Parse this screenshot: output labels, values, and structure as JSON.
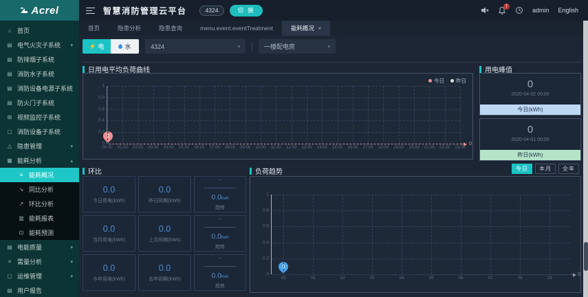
{
  "brand": {
    "logo_text": "Acrel"
  },
  "header": {
    "title": "智慧消防管理云平台",
    "badge": "4324",
    "switch_label": "切 换",
    "bell_count": "7",
    "user": "admin",
    "lang": "English"
  },
  "tabs": [
    {
      "label": "首页",
      "active": false,
      "closable": false
    },
    {
      "label": "隐患分析",
      "active": false,
      "closable": false
    },
    {
      "label": "隐患查询",
      "active": false,
      "closable": false
    },
    {
      "label": "menu.event.eventTreatment",
      "active": false,
      "closable": false
    },
    {
      "label": "能耗概况",
      "active": true,
      "closable": true
    }
  ],
  "filters": {
    "electric_label": "电",
    "water_label": "水",
    "device_select_value": "4324",
    "room_select_value": "一楼配电房"
  },
  "sidebar": {
    "items": [
      {
        "label": "首页",
        "icon": "home"
      },
      {
        "label": "电气火灾子系统",
        "icon": "panel",
        "chevron": "down"
      },
      {
        "label": "防排烟子系统",
        "icon": "panel"
      },
      {
        "label": "消防水子系统",
        "icon": "panel"
      },
      {
        "label": "消防设备电源子系统",
        "icon": "panel"
      },
      {
        "label": "防火门子系统",
        "icon": "panel"
      },
      {
        "label": "视频监控子系统",
        "icon": "video"
      },
      {
        "label": "消防设备子系统",
        "icon": "device"
      },
      {
        "label": "隐患管理",
        "icon": "warn",
        "chevron": "down"
      },
      {
        "label": "能耗分析",
        "icon": "energy",
        "chevron": "up",
        "expanded": true
      }
    ],
    "submenu": [
      {
        "label": "能耗概况",
        "icon": "list",
        "active": true
      },
      {
        "label": "同比分析",
        "icon": "down-trend"
      },
      {
        "label": "环比分析",
        "icon": "up-trend"
      },
      {
        "label": "能耗报表",
        "icon": "report"
      },
      {
        "label": "能耗预测",
        "icon": "forecast"
      }
    ],
    "items_after": [
      {
        "label": "电能质量",
        "icon": "panel",
        "chevron": "down"
      },
      {
        "label": "需量分析",
        "icon": "list",
        "chevron": "down"
      },
      {
        "label": "运维管理",
        "icon": "device",
        "chevron": "down"
      },
      {
        "label": "用户报告",
        "icon": "panel"
      }
    ]
  },
  "daily_chart": {
    "title": "日用电平均负荷曲线",
    "legend": [
      {
        "label": "今日",
        "color": "#f0908f"
      },
      {
        "label": "昨日",
        "color": "#dde3ea"
      }
    ],
    "y_ticks": [
      "1",
      "0.8",
      "0.6",
      "0.4",
      "0.2",
      "0"
    ],
    "x_ticks": [
      "00:00",
      "01:00",
      "02:00",
      "03:00",
      "04:00",
      "05:00",
      "06:00",
      "07:00",
      "08:00",
      "09:00",
      "10:00",
      "11:00",
      "12:00",
      "13:00",
      "14:00",
      "15:00",
      "16:00",
      "17:00",
      "18:00",
      "19:00",
      "20:00",
      "21:00",
      "22:00",
      "23:00"
    ],
    "marker_value": "0",
    "axis_end_label": "0"
  },
  "peak_panel": {
    "title": "用电峰值",
    "cards": [
      {
        "value": "0",
        "date": "2020-04-02 00:00",
        "label": "今日(kWh)",
        "footer_color": "#bdd8f3"
      },
      {
        "value": "0",
        "date": "2020-04-01 00:00",
        "label": "昨日(kWh)",
        "footer_color": "#b5e4c8"
      }
    ]
  },
  "ratio_panel": {
    "title": "环比",
    "rows": [
      {
        "left": {
          "value": "0.0",
          "label": "今日用电(kWh)"
        },
        "mid": {
          "value": "0.0",
          "label": "昨日同期(kWh)"
        },
        "trend": {
          "numerator": "--",
          "value": "0.0",
          "unit": "kwh",
          "label": "趋势"
        }
      },
      {
        "left": {
          "value": "0.0",
          "label": "当月用电(kWh)"
        },
        "mid": {
          "value": "0.0",
          "label": "上月同期(kWh)"
        },
        "trend": {
          "numerator": "--",
          "value": "0.0",
          "unit": "kwh",
          "label": "趋势"
        }
      },
      {
        "left": {
          "value": "0.0",
          "label": "今年用电(kWh)"
        },
        "mid": {
          "value": "0.0",
          "label": "去年同期(kWh)"
        },
        "trend": {
          "numerator": "--",
          "value": "0.0",
          "unit": "kwh",
          "label": "趋势"
        }
      }
    ]
  },
  "trend_chart": {
    "title": "负荷趋势",
    "tabs": [
      {
        "label": "今日",
        "active": true
      },
      {
        "label": "本月",
        "active": false
      },
      {
        "label": "全年",
        "active": false
      }
    ],
    "y_ticks": [
      "1",
      "0.8",
      "0.6",
      "0.4",
      "0.2",
      "0"
    ],
    "x_ticks": [
      "00",
      "01",
      "02",
      "03",
      "04",
      "05",
      "06",
      "07",
      "08",
      "09"
    ],
    "marker_value": "0",
    "axis_end_label": "0"
  },
  "chart_data": [
    {
      "type": "line",
      "title": "日用电平均负荷曲线",
      "x": [
        "00:00",
        "01:00",
        "02:00",
        "03:00",
        "04:00",
        "05:00",
        "06:00",
        "07:00",
        "08:00",
        "09:00",
        "10:00",
        "11:00",
        "12:00",
        "13:00",
        "14:00",
        "15:00",
        "16:00",
        "17:00",
        "18:00",
        "19:00",
        "20:00",
        "21:00",
        "22:00",
        "23:00"
      ],
      "series": [
        {
          "name": "今日",
          "color": "#f0908f",
          "values": [
            0
          ]
        },
        {
          "name": "昨日",
          "color": "#dde3ea",
          "values": []
        }
      ],
      "ylim": [
        0,
        1
      ],
      "grid": true,
      "legend_position": "top-right",
      "annotation": "marker pin value 0 at 00:00; axis end label 0"
    },
    {
      "type": "line",
      "title": "负荷趋势",
      "x": [
        "00",
        "01",
        "02",
        "03",
        "04",
        "05",
        "06",
        "07",
        "08",
        "09"
      ],
      "series": [
        {
          "name": "今日",
          "color": "#4aa3e8",
          "values": [
            0
          ]
        }
      ],
      "ylim": [
        0,
        1
      ],
      "grid": true,
      "annotation": "marker pin value 0 at 00; axis end label 0"
    }
  ],
  "colors": {
    "accent_teal": "#1fc2c4",
    "today_pink": "#f0908f",
    "yesterday_gray": "#dde3ea",
    "stat_blue": "#4b8fd2",
    "peak_today_footer": "#bdd8f3",
    "peak_yesterday_footer": "#b5e4c8",
    "sidebar_bg": "#0c3434",
    "active_menu": "#1ec6c6"
  }
}
